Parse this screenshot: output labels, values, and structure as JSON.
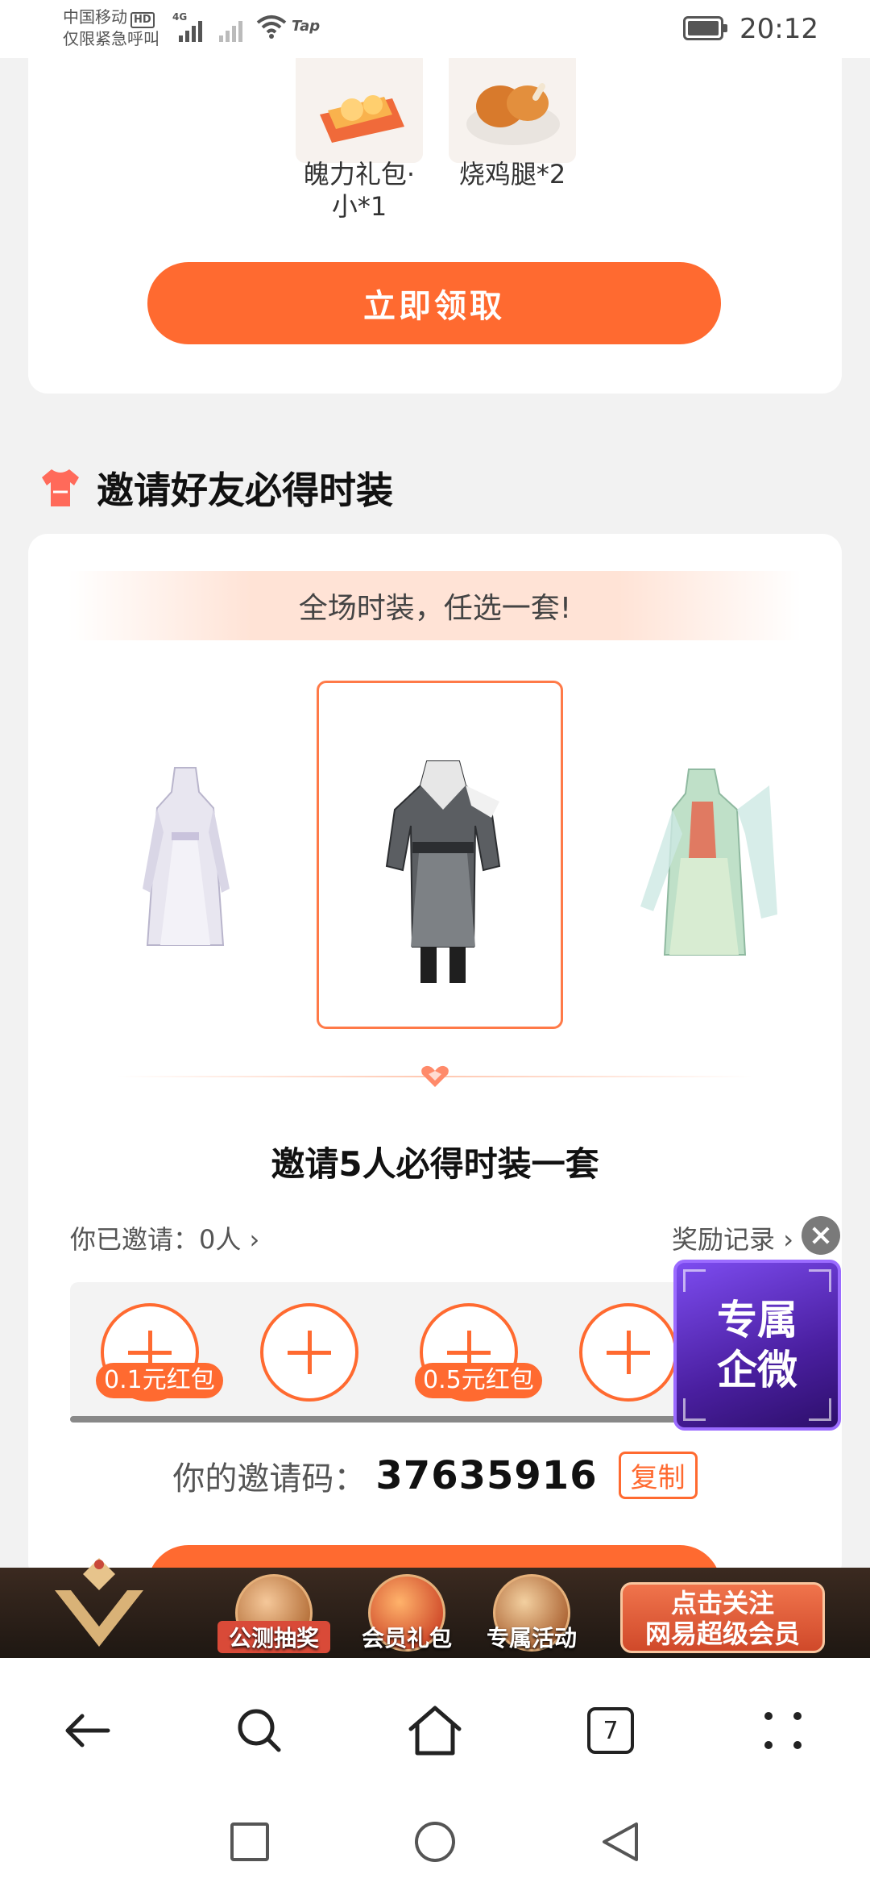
{
  "status_bar": {
    "carrier_line1": "中国移动",
    "carrier_hd": "HD",
    "carrier_line2": "仅限紧急呼叫",
    "network": "4G",
    "extra_app": "Tap",
    "time": "20:12"
  },
  "top_card": {
    "items": [
      {
        "label": "魄力礼包·\n小*1",
        "icon": "gift-pack-icon"
      },
      {
        "label": "烧鸡腿*2",
        "icon": "roast-chicken-leg-icon"
      }
    ],
    "claim_button": "立即领取"
  },
  "invite_section": {
    "title": "邀请好友必得时装",
    "title_icon": "tshirt-icon",
    "banner_text": "全场时装，任选一套!",
    "outfits": [
      "white-dress-outfit",
      "black-grey-outfit",
      "green-dress-outfit"
    ],
    "selected_outfit_index": 1,
    "invite_title": "邀请5人必得时装一套",
    "invited_label": "你已邀请：0人 ›",
    "records_label": "奖励记录 ›",
    "slots": [
      {
        "reward": "0.1元红包"
      },
      {
        "reward": ""
      },
      {
        "reward": "0.5元红包"
      },
      {
        "reward": ""
      }
    ],
    "code_label": "你的邀请码：",
    "code_value": "37635916",
    "copy_label": "复制"
  },
  "float_widget": {
    "line1": "专属",
    "line2": "企微"
  },
  "ad_bar": {
    "items": [
      "公测抽奖",
      "会员礼包",
      "专属活动"
    ],
    "cta_line1": "点击关注",
    "cta_line2": "网易超级会员"
  },
  "browser_toolbar": {
    "tab_count": "7"
  },
  "colors": {
    "accent": "#ff6a30",
    "page_bg": "#f2f2f2",
    "widget_purple": "#5a2bc4"
  }
}
